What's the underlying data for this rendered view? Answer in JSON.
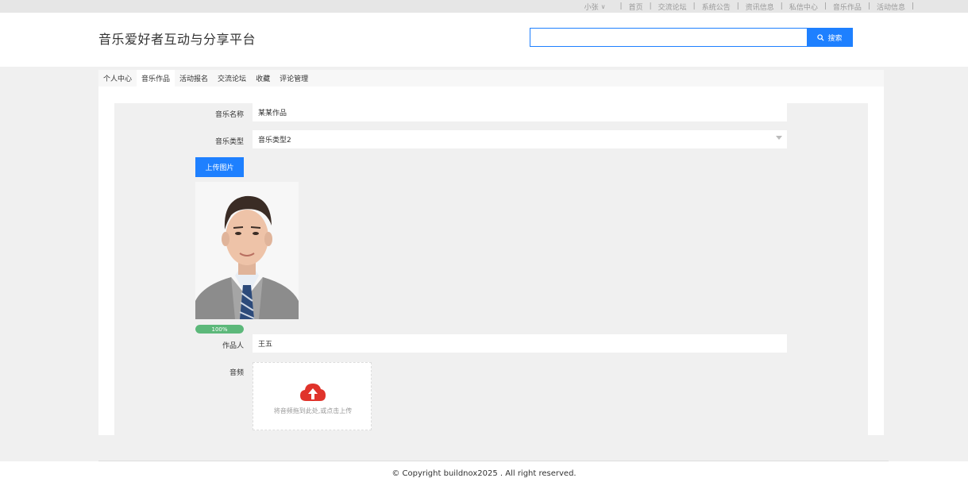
{
  "topnav": {
    "user": "小张",
    "links": [
      "首页",
      "交流论坛",
      "系统公告",
      "资讯信息",
      "私信中心",
      "音乐作品",
      "活动信息"
    ]
  },
  "header": {
    "title": "音乐爱好者互动与分享平台",
    "search_value": "",
    "search_button": "搜索"
  },
  "tabs": [
    "个人中心",
    "音乐作品",
    "活动报名",
    "交流论坛",
    "收藏",
    "评论管理"
  ],
  "active_tab": 1,
  "form": {
    "name_label": "音乐名称",
    "name_value": "某某作品",
    "type_label": "音乐类型",
    "type_value": "音乐类型2",
    "upload_button": "上传图片",
    "upload_progress_text": "100%",
    "upload_progress": 1.0,
    "author_label": "作品人",
    "author_value": "王五",
    "audio_label": "音频",
    "audio_drop_text": "将音频拖到此处,或点击上传"
  },
  "colors": {
    "primary": "#1e80ff",
    "progress": "#5cb87a",
    "upload_icon": "#e0332b"
  },
  "footer": {
    "copyright": "© Copyright buildnox2025 . All right reserved."
  }
}
